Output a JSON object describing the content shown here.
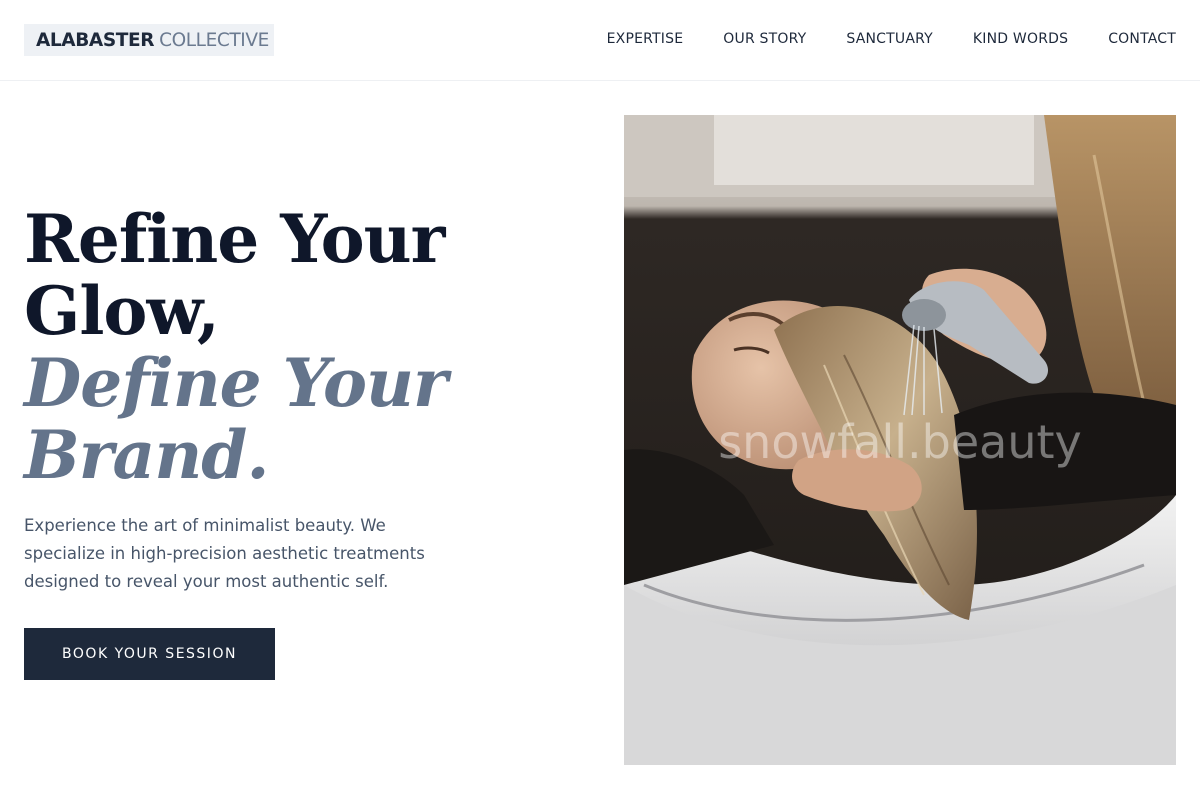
{
  "brand": {
    "name_bold": "ALABASTER",
    "name_light": "COLLECTIVE"
  },
  "nav": {
    "items": [
      {
        "label": "EXPERTISE"
      },
      {
        "label": "OUR STORY"
      },
      {
        "label": "SANCTUARY"
      },
      {
        "label": "KIND WORDS"
      },
      {
        "label": "CONTACT"
      }
    ]
  },
  "hero": {
    "headline_line1": "Refine Your",
    "headline_line2": "Glow,",
    "headline_line3": "Define Your",
    "headline_line4": "Brand.",
    "intro": "Experience the art of minimalist beauty. We specialize in high-precision aesthetic treatments designed to reveal your most authentic self.",
    "cta_label": "BOOK YOUR SESSION",
    "image_alt": "Stylist rinsing a client's hair at a salon wash basin",
    "watermark": "snowfall.beauty"
  },
  "colors": {
    "primary": "#1e293b",
    "accent_text": "#64748b",
    "body_text": "#475569",
    "logo_bg": "#eef1f5"
  }
}
